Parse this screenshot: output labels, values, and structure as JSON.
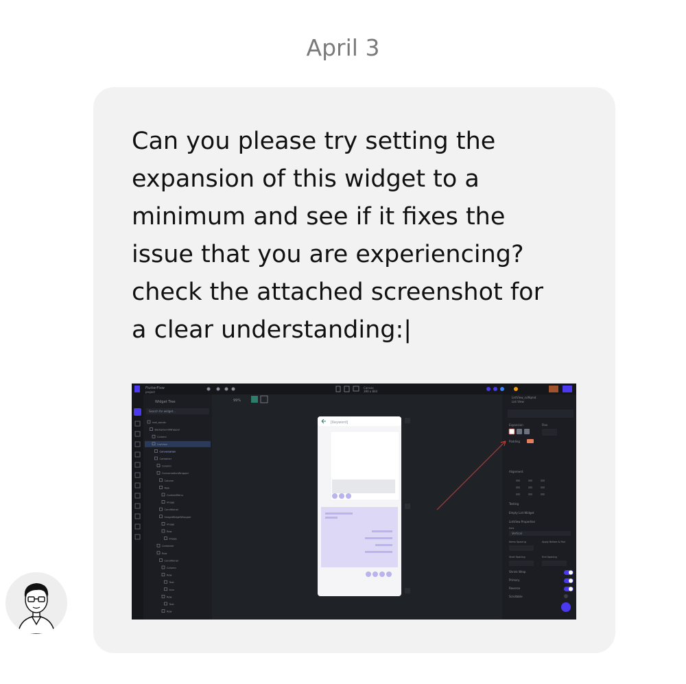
{
  "date_label": "April 3",
  "message": {
    "text": "Can you please try setting the expansion of this widget to a minimum and see if it fixes the issue that you are experiencing? check the attached screenshot for a clear understanding:|",
    "lines": [
      "Can you please try setting the",
      "expansion of this widget to a",
      "minimum and see if it fixes the",
      "issue that you are experiencing?",
      "check the attached screenshot for",
      "a clear understanding:|"
    ]
  },
  "attachment": {
    "app_title": "FlutterFlow",
    "project": "project",
    "widget_tree_label": "Widget Tree",
    "search_placeholder": "Search for widget...",
    "zoom": "99%",
    "canvas_title": "[Keyword]",
    "right_panel": {
      "widget_name": "ListView_scl9qmd",
      "widget_type": "List View",
      "expansion_label": "Expansion",
      "flex_label": "Flex",
      "padding_label": "Padding",
      "alignment_label": "Alignment",
      "sections": [
        "Testing",
        "Empty List Widget",
        "ListView Properties"
      ],
      "axis_label": "Axis",
      "axis_value": "Vertical",
      "items_spacing": "Items Spacing",
      "apply_first_last": "Apply Before & Pad",
      "start_spacing": "Start Spacing",
      "end_spacing": "End Spacing",
      "toggles": [
        "Shrink Wrap",
        "Primary",
        "Reverse",
        "Scrollable"
      ]
    },
    "tree_items": [
      "rest_ssoutc",
      "BackgroundWrapper",
      "Column",
      "ListView",
      "Conversation",
      "Container",
      "Column",
      "ConversationWrapper",
      "Column",
      "Row",
      "ContextMenu",
      "Image",
      "Conditional",
      "ImageWidgetWrapper",
      "Image",
      "Row",
      "Image",
      "Container",
      "Row",
      "Conditional",
      "Column",
      "Row",
      "Text",
      "Icon",
      "Row",
      "Text",
      "Row"
    ],
    "arrow_color": "#c0392b",
    "accent_color": "#4b39ef"
  },
  "colors": {
    "bubble": "#f2f2f2",
    "date_text": "#7a7a7a",
    "message_text": "#111111"
  }
}
